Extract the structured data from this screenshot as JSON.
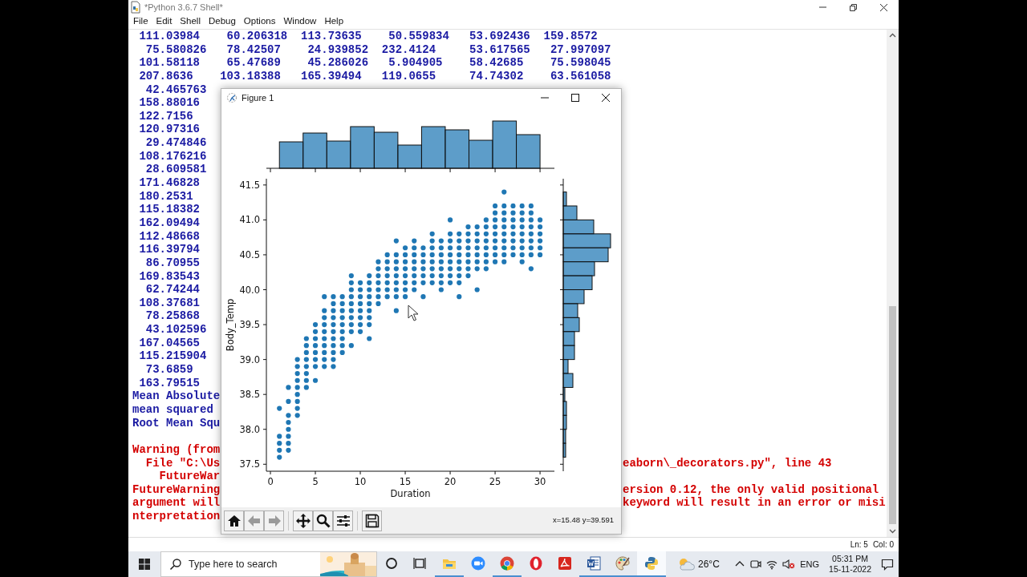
{
  "shell_window": {
    "title": "*Python 3.6.7 Shell*",
    "menu": [
      "File",
      "Edit",
      "Shell",
      "Debug",
      "Options",
      "Window",
      "Help"
    ],
    "output": [
      {
        "kind": "stdout",
        "text": " 111.03984    60.206318  113.73635    50.559834   53.692436  159.8572"
      },
      {
        "kind": "stdout",
        "text": "  75.580826   78.42507    24.939852  232.4124     53.617565   27.997097"
      },
      {
        "kind": "stdout",
        "text": " 101.58118    65.47689    45.286026   5.904905    58.42685    75.598045"
      },
      {
        "kind": "stdout",
        "text": " 207.8636    103.18388   165.39494   119.0655     74.74302    63.561058"
      },
      {
        "kind": "stdout",
        "text": "  42.465763"
      },
      {
        "kind": "stdout",
        "text": " 158.88016"
      },
      {
        "kind": "stdout",
        "text": " 122.7156"
      },
      {
        "kind": "stdout",
        "text": " 120.97316"
      },
      {
        "kind": "stdout",
        "text": "  29.474846"
      },
      {
        "kind": "stdout",
        "text": " 108.176216"
      },
      {
        "kind": "stdout",
        "text": "  28.609581"
      },
      {
        "kind": "stdout",
        "text": " 171.46828"
      },
      {
        "kind": "stdout",
        "text": " 180.2531"
      },
      {
        "kind": "stdout",
        "text": " 115.18382"
      },
      {
        "kind": "stdout",
        "text": " 162.09494"
      },
      {
        "kind": "stdout",
        "text": " 112.48668"
      },
      {
        "kind": "stdout",
        "text": " 116.39794"
      },
      {
        "kind": "stdout",
        "text": "  86.70955"
      },
      {
        "kind": "stdout",
        "text": " 169.83543"
      },
      {
        "kind": "stdout",
        "text": "  62.74244"
      },
      {
        "kind": "stdout",
        "text": " 108.37681"
      },
      {
        "kind": "stdout",
        "text": "  78.25868"
      },
      {
        "kind": "stdout",
        "text": "  43.102596"
      },
      {
        "kind": "stdout",
        "text": " 167.04565"
      },
      {
        "kind": "stdout",
        "text": " 115.215904"
      },
      {
        "kind": "stdout",
        "text": "  73.6859"
      },
      {
        "kind": "stdout",
        "text": " 163.79515"
      },
      {
        "kind": "stdout",
        "text": "Mean Absolute"
      },
      {
        "kind": "stdout",
        "text": "mean squared"
      },
      {
        "kind": "stdout",
        "text": "Root Mean Squ"
      },
      {
        "kind": "blank"
      },
      {
        "kind": "stderr",
        "text": "Warning (from"
      },
      {
        "kind": "stderr",
        "text": "  File \"C:\\Us",
        "text_right": "eaborn\\_decorators.py\", line 43"
      },
      {
        "kind": "stderr",
        "text": "    FutureWar"
      },
      {
        "kind": "stderr",
        "text": "FutureWarning",
        "text_right": "ersion 0.12, the only valid positional"
      },
      {
        "kind": "stderr",
        "text": "argument will",
        "text_right": "keyword will result in an error or misi"
      },
      {
        "kind": "stderr",
        "text": "nterpretation"
      }
    ],
    "status_bar": {
      "line": "Ln: 5",
      "column": "Col: 0"
    }
  },
  "figure_window": {
    "title": "Figure 1",
    "chart_data": {
      "type": "scatter",
      "xlabel": "Duration",
      "ylabel": "Body_Temp",
      "xlim": [
        -0.45,
        31.6
      ],
      "ylim": [
        37.4,
        41.59
      ],
      "xticks": [
        0,
        5,
        10,
        15,
        20,
        25,
        30
      ],
      "yticks": [
        37.5,
        {
          "value": 38,
          "label": "38.0"
        },
        38.5,
        {
          "value": 39,
          "label": "39.0"
        },
        39.5,
        {
          "value": 40,
          "label": "40.0"
        },
        40.5,
        {
          "value": 41,
          "label": "41.0"
        },
        41.5
      ],
      "x": [
        1,
        1,
        1,
        1,
        1,
        2,
        2,
        2,
        2,
        2,
        2,
        2,
        2,
        3,
        3,
        3,
        3,
        3,
        3,
        3,
        3,
        3,
        4,
        4,
        4,
        4,
        4,
        4,
        4,
        4,
        5,
        5,
        5,
        5,
        5,
        5,
        5,
        5,
        6,
        6,
        6,
        6,
        6,
        6,
        6,
        6,
        6,
        6,
        7,
        7,
        7,
        7,
        7,
        7,
        7,
        7,
        7,
        7,
        7,
        8,
        8,
        8,
        8,
        8,
        8,
        8,
        8,
        8,
        9,
        9,
        9,
        9,
        9,
        9,
        9,
        9,
        9,
        9,
        10,
        10,
        10,
        10,
        10,
        10,
        10,
        10,
        11,
        11,
        11,
        11,
        11,
        11,
        11,
        11,
        11,
        12,
        12,
        12,
        12,
        12,
        12,
        12,
        13,
        13,
        13,
        13,
        13,
        13,
        13,
        14,
        14,
        14,
        14,
        14,
        14,
        14,
        14,
        14,
        15,
        15,
        15,
        15,
        15,
        15,
        15,
        15,
        16,
        16,
        16,
        16,
        16,
        16,
        16,
        16,
        17,
        17,
        17,
        17,
        17,
        17,
        17,
        18,
        18,
        18,
        18,
        18,
        18,
        18,
        18,
        19,
        19,
        19,
        19,
        19,
        19,
        19,
        19,
        20,
        20,
        20,
        20,
        20,
        20,
        20,
        20,
        20,
        21,
        21,
        21,
        21,
        21,
        21,
        21,
        21,
        21,
        22,
        22,
        22,
        22,
        22,
        22,
        22,
        22,
        23,
        23,
        23,
        23,
        23,
        23,
        23,
        23,
        24,
        24,
        24,
        24,
        24,
        24,
        24,
        24,
        25,
        25,
        25,
        25,
        25,
        25,
        25,
        25,
        25,
        26,
        26,
        26,
        26,
        26,
        26,
        26,
        26,
        26,
        26,
        27,
        27,
        27,
        27,
        27,
        27,
        27,
        27,
        28,
        28,
        28,
        28,
        28,
        28,
        28,
        28,
        28,
        29,
        29,
        29,
        29,
        29,
        29,
        29,
        29,
        29,
        30,
        30,
        30,
        30,
        30,
        30
      ],
      "series": [
        {
          "color": "#1f77b4",
          "values": [
            37.6,
            37.7,
            37.8,
            37.9,
            38.3,
            37.7,
            37.8,
            37.9,
            38,
            38.1,
            38.2,
            38.4,
            38.6,
            38.2,
            38.3,
            38.4,
            38.5,
            38.6,
            38.7,
            38.8,
            38.9,
            39,
            38.6,
            38.7,
            38.8,
            38.9,
            39,
            39.1,
            39.2,
            39.3,
            38.7,
            38.9,
            39,
            39.1,
            39.2,
            39.3,
            39.4,
            39.5,
            38.9,
            39,
            39.1,
            39.2,
            39.3,
            39.4,
            39.5,
            39.6,
            39.7,
            39.9,
            38.9,
            39,
            39.1,
            39.2,
            39.3,
            39.4,
            39.5,
            39.6,
            39.7,
            39.8,
            39.9,
            39.1,
            39.2,
            39.3,
            39.4,
            39.5,
            39.6,
            39.7,
            39.8,
            39.9,
            39.2,
            39.4,
            39.5,
            39.6,
            39.7,
            39.8,
            39.9,
            40,
            40.1,
            40.2,
            39.4,
            39.5,
            39.6,
            39.7,
            39.8,
            39.9,
            40,
            40.1,
            39.3,
            39.5,
            39.6,
            39.7,
            39.8,
            39.9,
            40,
            40.1,
            40.2,
            39.8,
            39.9,
            40,
            40.1,
            40.2,
            40.3,
            40.4,
            39.9,
            40,
            40.1,
            40.2,
            40.3,
            40.4,
            40.5,
            39.7,
            39.9,
            40,
            40.1,
            40.2,
            40.3,
            40.4,
            40.5,
            40.7,
            39.9,
            40,
            40.1,
            40.2,
            40.3,
            40.4,
            40.5,
            40.6,
            40,
            40.1,
            40.2,
            40.3,
            40.4,
            40.5,
            40.6,
            40.7,
            39.9,
            40.1,
            40.2,
            40.3,
            40.4,
            40.5,
            40.6,
            40.1,
            40.2,
            40.3,
            40.4,
            40.5,
            40.6,
            40.7,
            40.8,
            40,
            40.1,
            40.2,
            40.3,
            40.4,
            40.5,
            40.6,
            40.7,
            40.1,
            40.2,
            40.3,
            40.4,
            40.5,
            40.6,
            40.7,
            40.8,
            41,
            39.9,
            40.1,
            40.2,
            40.3,
            40.4,
            40.5,
            40.6,
            40.7,
            40.8,
            40.2,
            40.3,
            40.4,
            40.5,
            40.6,
            40.7,
            40.8,
            40.9,
            40,
            40.3,
            40.4,
            40.5,
            40.6,
            40.7,
            40.8,
            40.9,
            40.3,
            40.4,
            40.5,
            40.6,
            40.7,
            40.8,
            40.9,
            41,
            40.4,
            40.5,
            40.6,
            40.7,
            40.8,
            40.9,
            41,
            41.1,
            41.2,
            40.4,
            40.5,
            40.6,
            40.7,
            40.8,
            40.9,
            41,
            41.1,
            41.2,
            41.4,
            40.5,
            40.6,
            40.7,
            40.8,
            40.9,
            41,
            41.1,
            41.2,
            40.4,
            40.5,
            40.6,
            40.7,
            40.8,
            40.9,
            41,
            41.1,
            41.2,
            40.3,
            40.5,
            40.6,
            40.7,
            40.8,
            40.9,
            41,
            41.1,
            41.2,
            40.5,
            40.6,
            40.7,
            40.8,
            40.9,
            41
          ]
        }
      ]
    },
    "toolbar": [
      [
        {
          "kind": "home",
          "disabled": false
        },
        {
          "kind": "back",
          "disabled": true
        },
        {
          "kind": "forward",
          "disabled": true
        }
      ],
      [
        {
          "kind": "pan",
          "disabled": false
        },
        {
          "kind": "zoom",
          "disabled": false
        },
        {
          "kind": "configure",
          "disabled": false
        }
      ],
      [
        {
          "kind": "save",
          "disabled": false
        }
      ]
    ],
    "coordinates": "x=15.48 y=39.591"
  },
  "taskbar": {
    "search": {
      "placeholder": "Type here to search"
    },
    "apps": [
      {
        "kind": "explorer",
        "running": true,
        "selected": false
      },
      {
        "kind": "zoom",
        "running": false,
        "selected": false
      },
      {
        "kind": "chrome",
        "running": true,
        "selected": false
      },
      {
        "kind": "opera",
        "running": false,
        "selected": false
      },
      {
        "kind": "acrobat",
        "running": false,
        "selected": false
      },
      {
        "kind": "word",
        "running": true,
        "selected": false
      },
      {
        "kind": "paint",
        "running": true,
        "selected": false
      },
      {
        "kind": "python",
        "running": true,
        "selected": true
      }
    ],
    "weather": {
      "temperature": "26°C"
    },
    "language": "ENG",
    "time": "05:31 PM",
    "date": "15-11-2022"
  }
}
